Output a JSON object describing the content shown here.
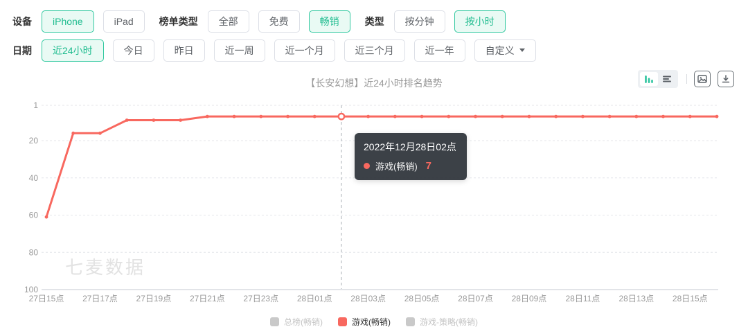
{
  "colors": {
    "accent_green": "#1fbc8f",
    "accent_green_border": "#30c89f",
    "accent_green_bg": "#e9faf4",
    "series_red": "#f8685f",
    "inactive_gray": "#c9c9c9",
    "tooltip_bg": "#2d3339"
  },
  "filters": {
    "rows": [
      {
        "groups": [
          {
            "label": "设备",
            "name": "device",
            "options": [
              {
                "text": "iPhone",
                "selected": true
              },
              {
                "text": "iPad",
                "selected": false
              }
            ]
          },
          {
            "label": "榜单类型",
            "name": "rank-type",
            "options": [
              {
                "text": "全部",
                "selected": false
              },
              {
                "text": "免费",
                "selected": false
              },
              {
                "text": "畅销",
                "selected": true
              }
            ]
          },
          {
            "label": "类型",
            "name": "granularity",
            "options": [
              {
                "text": "按分钟",
                "selected": false
              },
              {
                "text": "按小时",
                "selected": true
              }
            ]
          }
        ]
      },
      {
        "groups": [
          {
            "label": "日期",
            "name": "date-range",
            "options": [
              {
                "text": "近24小时",
                "selected": true
              },
              {
                "text": "今日",
                "selected": false
              },
              {
                "text": "昨日",
                "selected": false
              },
              {
                "text": "近一周",
                "selected": false
              },
              {
                "text": "近一个月",
                "selected": false
              },
              {
                "text": "近三个月",
                "selected": false
              },
              {
                "text": "近一年",
                "selected": false
              },
              {
                "text": "自定义",
                "selected": false,
                "dropdown": true
              }
            ]
          }
        ]
      }
    ]
  },
  "chart": {
    "title": "【长安幻想】近24小时排名趋势",
    "watermark": "七麦数据",
    "tools": {
      "view_toggle": [
        {
          "icon": "bar-chart-icon",
          "selected": true
        },
        {
          "icon": "list-icon",
          "selected": false
        }
      ],
      "buttons": [
        {
          "icon": "export-image-icon"
        },
        {
          "icon": "download-icon"
        }
      ]
    }
  },
  "tooltip": {
    "title": "2022年12月28日02点",
    "series": "游戏(畅销)",
    "value": "7"
  },
  "legend": [
    {
      "label": "总榜(畅销)",
      "active": false
    },
    {
      "label": "游戏(畅销)",
      "active": true,
      "color": "#f8685f"
    },
    {
      "label": "游戏-策略(畅销)",
      "active": false
    }
  ],
  "chart_data": {
    "type": "line",
    "title": "【长安幻想】近24小时排名趋势",
    "x": [
      "27日15点",
      "27日16点",
      "27日17点",
      "27日18点",
      "27日19点",
      "27日20点",
      "27日21点",
      "27日22点",
      "27日23点",
      "28日00点",
      "28日01点",
      "28日02点",
      "28日03点",
      "28日04点",
      "28日05点",
      "28日06点",
      "28日07点",
      "28日08点",
      "28日09点",
      "28日10点",
      "28日11点",
      "28日12点",
      "28日13点",
      "28日14点",
      "28日15点",
      "28日16点"
    ],
    "visible_tick_labels": [
      "27日15点",
      "27日17点",
      "27日19点",
      "27日21点",
      "27日23点",
      "28日01点",
      "28日03点",
      "28日05点",
      "28日07点",
      "28日09点",
      "28日11点",
      "28日13点",
      "28日15点"
    ],
    "series": [
      {
        "name": "游戏(畅销)",
        "color": "#f8685f",
        "values": [
          61,
          16,
          16,
          9,
          9,
          9,
          7,
          7,
          7,
          7,
          7,
          7,
          7,
          7,
          7,
          7,
          7,
          7,
          7,
          7,
          7,
          7,
          7,
          7,
          7,
          7
        ]
      }
    ],
    "yticks": [
      1,
      20,
      40,
      60,
      80,
      100
    ],
    "ylim": [
      1,
      100
    ],
    "y_inverted": true,
    "grid": "dashed-horizontal",
    "hover_index": 11,
    "hover_value": 7,
    "legend_position": "bottom"
  }
}
